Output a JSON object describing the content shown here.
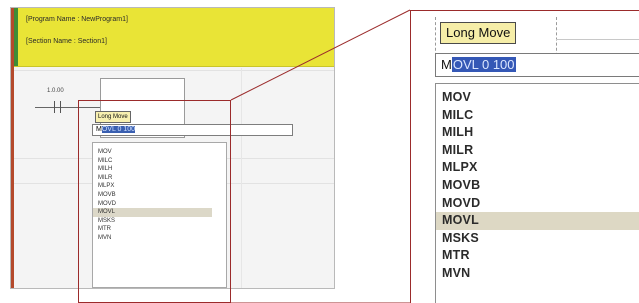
{
  "editor": {
    "program_name": "[Program Name : NewProgram1]",
    "section_name": "[Section Name : Section1]",
    "contact_address": "1.0.00"
  },
  "popup": {
    "tooltip": "Long Move",
    "typed_prefix": "M",
    "typed_selected": "OVL 0 100",
    "typed_selected_small": "OVL 0 100",
    "items": [
      "MOV",
      "MILC",
      "MILH",
      "MILR",
      "MLPX",
      "MOVB",
      "MOVD",
      "MOVL",
      "MSKS",
      "MTR",
      "MVN"
    ],
    "highlighted_index": 7
  },
  "colors": {
    "header_yellow": "#e9e436",
    "callout_red": "#9b2b2b",
    "selection_blue": "#3558b6",
    "highlight": "#ddd8c4"
  }
}
